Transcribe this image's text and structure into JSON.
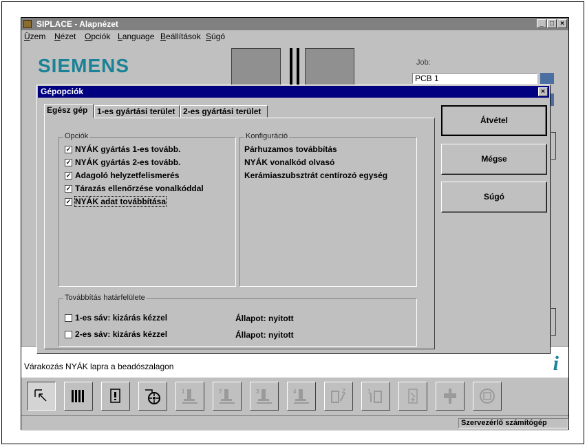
{
  "window": {
    "title": "SIPLACE - Alapnézet",
    "controls": {
      "minimize": "_",
      "maximize": "□",
      "close": "×"
    }
  },
  "menu": [
    "Üzem",
    "Nézet",
    "Opciók",
    "Language",
    "Beállítások",
    "Súgó"
  ],
  "logo": "SIEMENS",
  "job": {
    "label": "Job:",
    "value": "PCB 1"
  },
  "status_message": "Várakozás NYÁK lapra a beadószalagon",
  "bottom_status": "Szervezérlő számítógép",
  "toolbar_icons": [
    "select-pointer-icon",
    "component-grid-icon",
    "alert-panel-icon",
    "feeder-reel-icon",
    "placement-head-1-icon",
    "placement-head-2-icon",
    "placement-head-3-icon",
    "placement-head-4-icon",
    "conveyor-2-icon",
    "conveyor-1-icon",
    "nozzle-plus-icon",
    "station-icon",
    "refresh-disk-icon"
  ],
  "dialog": {
    "title": "Gépopciók",
    "tabs": [
      "Egész gép",
      "1-es gyártási terület",
      "2-es gyártási terület"
    ],
    "active_tab": 0,
    "options": {
      "legend": "Opciók",
      "items": [
        {
          "label": "NYÁK gyártás 1-es tovább.",
          "checked": true
        },
        {
          "label": "NYÁK gyártás 2-es tovább.",
          "checked": true
        },
        {
          "label": "Adagoló helyzetfelismerés",
          "checked": true
        },
        {
          "label": "Tárazás ellenőrzése vonalkóddal",
          "checked": true
        },
        {
          "label": "NYÁK adat továbbítása",
          "checked": true
        }
      ]
    },
    "config": {
      "legend": "Konfiguráció",
      "items": [
        "Párhuzamos továbbítás",
        "NYÁK vonalkód olvasó",
        "Kerámiaszubsztrát centírozó egység"
      ]
    },
    "interface": {
      "legend": "Továbbítás határfelülete",
      "rows": [
        {
          "label": "1-es sáv: kizárás kézzel",
          "checked": false,
          "status": "Állapot: nyitott"
        },
        {
          "label": "2-es sáv: kizárás kézzel",
          "checked": false,
          "status": "Állapot: nyitott"
        }
      ]
    },
    "buttons": {
      "ok": "Átvétel",
      "cancel": "Mégse",
      "help": "Súgó"
    }
  }
}
